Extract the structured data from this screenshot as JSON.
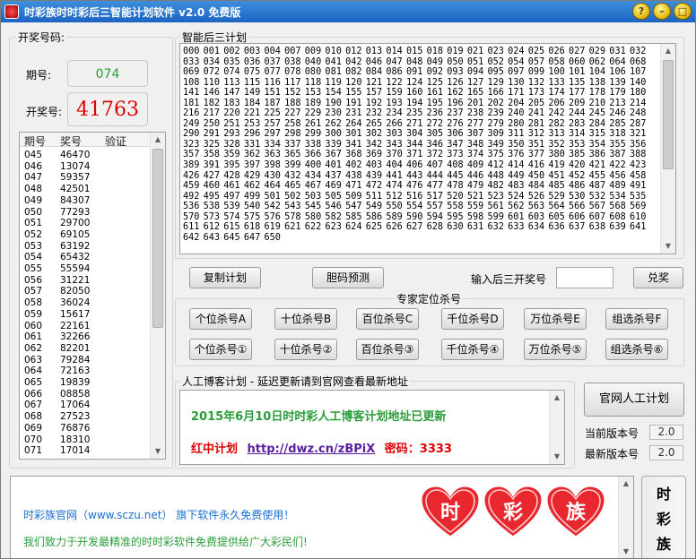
{
  "window": {
    "title": "时彩族时时彩后三智能计划软件 v2.0 免费版",
    "btn_help": "?",
    "btn_min": "–",
    "btn_max": "□",
    "btn_close": "×"
  },
  "lottery": {
    "group_label": "开奖号码:",
    "period_label": "期号:",
    "period_value": "074",
    "number_label": "开奖号:",
    "number_value": "41763",
    "history_headers": [
      "期号",
      "奖号",
      "验证"
    ],
    "history": [
      [
        "045",
        "46470"
      ],
      [
        "046",
        "13074"
      ],
      [
        "047",
        "59357"
      ],
      [
        "048",
        "42501"
      ],
      [
        "049",
        "84307"
      ],
      [
        "050",
        "77293"
      ],
      [
        "051",
        "29700"
      ],
      [
        "052",
        "69105"
      ],
      [
        "053",
        "63192"
      ],
      [
        "054",
        "65432"
      ],
      [
        "055",
        "55594"
      ],
      [
        "056",
        "31221"
      ],
      [
        "057",
        "82050"
      ],
      [
        "058",
        "36024"
      ],
      [
        "059",
        "15617"
      ],
      [
        "060",
        "22161"
      ],
      [
        "061",
        "32266"
      ],
      [
        "062",
        "82201"
      ],
      [
        "063",
        "79284"
      ],
      [
        "064",
        "72163"
      ],
      [
        "065",
        "19839"
      ],
      [
        "066",
        "08858"
      ],
      [
        "067",
        "17064"
      ],
      [
        "068",
        "27523"
      ],
      [
        "069",
        "76876"
      ],
      [
        "070",
        "18310"
      ],
      [
        "071",
        "17014"
      ]
    ]
  },
  "plan": {
    "group_label": "智能后三计划",
    "numbers": "000 001 002 003 004 007 009 010 012 013 014 015 018 019 021 023 024 025 026 027 029 031 032 033 034 035 036 037 038 040 041 042 046 047 048 049 050 051 052 054 057 058 060 062 064 068 069 072 074 075 077 078 080 081 082 084 086 091 092 093 094 095 097 099 100 101 104 106 107 108 110 113 115 116 117 118 119 120 121 122 124 125 126 127 129 130 132 133 135 138 139 140 141 146 147 149 151 152 153 154 155 157 159 160 161 162 165 166 171 173 174 177 178 179 180 181 182 183 184 187 188 189 190 191 192 193 194 195 196 201 202 204 205 206 209 210 213 214 216 217 220 221 225 227 229 230 231 232 234 235 236 237 238 239 240 241 242 244 245 246 248 249 250 251 253 257 258 261 262 264 265 266 271 272 276 277 279 280 281 282 283 284 285 287 290 291 293 296 297 298 299 300 301 302 303 304 305 306 307 309 311 312 313 314 315 318 321 323 325 328 331 334 337 338 339 341 342 343 344 346 347 348 349 350 351 352 353 354 355 356 357 358 359 362 363 365 366 367 368 369 370 371 372 373 374 375 376 377 380 385 386 387 388 389 391 395 397 398 399 400 401 402 403 404 406 407 408 409 412 414 416 419 420 421 422 423 426 427 428 429 430 432 434 437 438 439 441 443 444 445 446 448 449 450 451 452 455 456 458 459 460 461 462 464 465 467 469 471 472 474 476 477 478 479 482 483 484 485 486 487 489 491 492 495 497 499 501 502 503 505 509 511 512 516 517 520 521 523 524 526 529 530 532 534 535 536 538 539 540 542 543 545 546 547 549 550 554 557 558 559 561 562 563 564 566 567 568 569 570 573 574 575 576 578 580 582 585 586 589 590 594 595 598 599 601 603 605 606 607 608 610 611 612 615 618 619 621 622 623 624 625 626 627 628 630 631 632 633 634 636 637 638 639 641 642 643 645 647 650",
    "btn_copy": "复制计划",
    "btn_bold": "胆码预测",
    "input_label": "输入后三开奖号",
    "input_value": "",
    "btn_redeem": "兑奖",
    "expert_label": "专家定位杀号",
    "kill_row1": [
      "个位杀号A",
      "十位杀号B",
      "百位杀号C",
      "千位杀号D",
      "万位杀号E",
      "组选杀号F"
    ],
    "kill_row2": [
      "个位杀号①",
      "十位杀号②",
      "百位杀号③",
      "千位杀号④",
      "万位杀号⑤",
      "组选杀号⑥"
    ]
  },
  "blog": {
    "group_label": "人工博客计划 - 延迟更新请到官网查看最新地址",
    "headline": "2015年6月10日时时彩人工博客计划地址已更新",
    "link_prefix": "红中计划",
    "link_url": "http://dwz.cn/zBPiX",
    "pwd_text": "密码：3333"
  },
  "right_panel": {
    "btn_official": "官网人工计划",
    "current_ver_label": "当前版本号",
    "current_ver": "2.0",
    "latest_ver_label": "最新版本号",
    "latest_ver": "2.0"
  },
  "footer": {
    "line1": "时彩族官网（www.sczu.net） 旗下软件永久免费使用！",
    "line2": "我们致力于开发最精准的时时彩软件免费提供给广大彩民们!",
    "hearts": [
      "时",
      "彩",
      "族"
    ],
    "side_chars": [
      "时",
      "彩",
      "族"
    ]
  },
  "colors": {
    "title_bar": "#1c64c4",
    "period_green": "#2a9d3a",
    "winning_red": "#e00000",
    "headline_green": "#2a9d3a",
    "footer_blue": "#1a6fd6",
    "footer_green": "#2a9d3a",
    "heart_red": "#e8282e"
  }
}
